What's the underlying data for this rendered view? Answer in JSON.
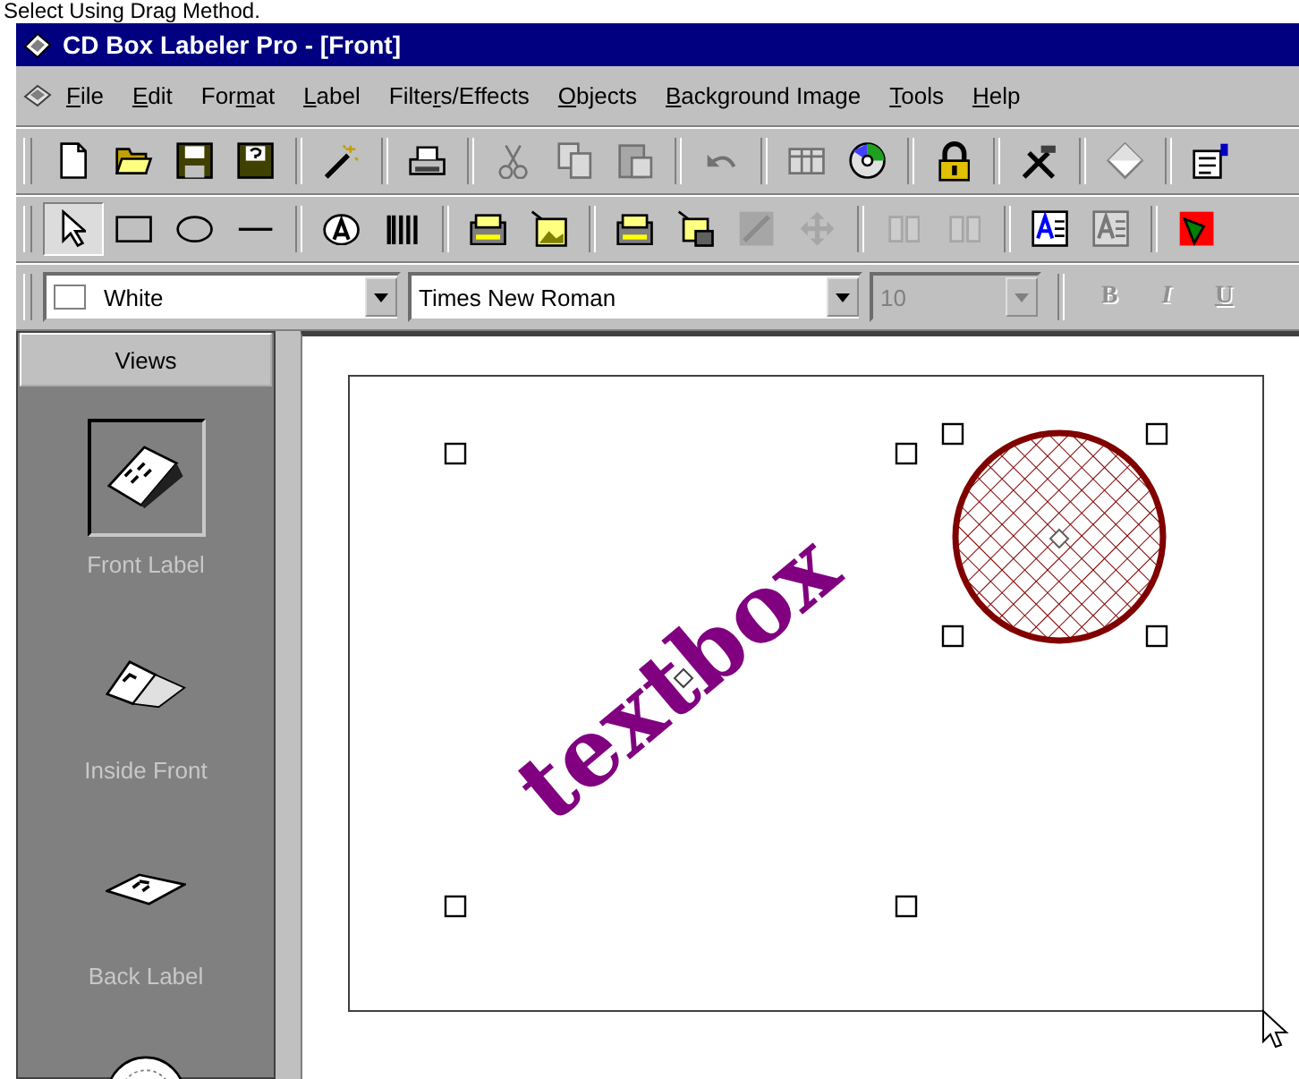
{
  "caption": "Select Using Drag Method.",
  "window": {
    "title": "CD Box Labeler Pro - [Front]"
  },
  "menu": [
    {
      "access_key": "F",
      "label_end": "ile"
    },
    {
      "access_key": "E",
      "label_end": "dit"
    },
    {
      "label_start": "For",
      "access_key": "m",
      "label_end": "at"
    },
    {
      "access_key": "L",
      "label_end": "abel"
    },
    {
      "label_start": "Filte",
      "access_key": "r",
      "label_end": "s/Effects"
    },
    {
      "access_key": "O",
      "label_end": "bjects"
    },
    {
      "access_key": "B",
      "label_end": "ackground Image"
    },
    {
      "access_key": "T",
      "label_end": "ools"
    },
    {
      "access_key": "H",
      "label_end": "elp"
    }
  ],
  "toolbars": [
    [
      {
        "kind": "new",
        "disabled": false
      },
      {
        "kind": "open",
        "disabled": false
      },
      {
        "kind": "save",
        "disabled": false
      },
      {
        "kind": "saveas",
        "disabled": false
      },
      {
        "kind": "separator"
      },
      {
        "kind": "wand",
        "disabled": false
      },
      {
        "kind": "separator"
      },
      {
        "kind": "print",
        "disabled": false
      },
      {
        "kind": "separator"
      },
      {
        "kind": "cut",
        "disabled": true
      },
      {
        "kind": "copy",
        "disabled": true
      },
      {
        "kind": "paste",
        "disabled": true
      },
      {
        "kind": "separator"
      },
      {
        "kind": "undo",
        "disabled": true
      },
      {
        "kind": "separator"
      },
      {
        "kind": "grid",
        "disabled": true
      },
      {
        "kind": "cd",
        "disabled": false
      },
      {
        "kind": "separator"
      },
      {
        "kind": "lock",
        "disabled": false
      },
      {
        "kind": "separator"
      },
      {
        "kind": "tools",
        "disabled": false
      },
      {
        "kind": "separator"
      },
      {
        "kind": "diamond",
        "disabled": false
      },
      {
        "kind": "separator"
      },
      {
        "kind": "props",
        "disabled": false
      }
    ],
    [
      {
        "kind": "pointer",
        "disabled": false,
        "selected": true
      },
      {
        "kind": "rect",
        "disabled": false,
        "selected": false
      },
      {
        "kind": "ellipse",
        "disabled": false,
        "selected": false
      },
      {
        "kind": "line",
        "disabled": false,
        "selected": false
      },
      {
        "kind": "separator"
      },
      {
        "kind": "texttool",
        "disabled": false
      },
      {
        "kind": "barcode",
        "disabled": false
      },
      {
        "kind": "separator"
      },
      {
        "kind": "scanner",
        "disabled": false
      },
      {
        "kind": "picture",
        "disabled": false
      },
      {
        "kind": "separator"
      },
      {
        "kind": "scanner",
        "disabled": false
      },
      {
        "kind": "pictures",
        "disabled": false
      },
      {
        "kind": "resize",
        "disabled": true
      },
      {
        "kind": "move",
        "disabled": true
      },
      {
        "kind": "separator"
      },
      {
        "kind": "flip",
        "disabled": true
      },
      {
        "kind": "flip",
        "disabled": true
      },
      {
        "kind": "separator"
      },
      {
        "kind": "textframe",
        "disabled": false
      },
      {
        "kind": "textframe",
        "disabled": true
      },
      {
        "kind": "separator"
      },
      {
        "kind": "framedpicture",
        "disabled": false
      }
    ]
  ],
  "format_bar": {
    "color": {
      "value": "White"
    },
    "font": {
      "value": "Times New Roman",
      "disabled": false
    },
    "size": {
      "value": "10",
      "disabled": true
    },
    "style_buttons": [
      {
        "label": "B",
        "kind": "bold",
        "disabled": true
      },
      {
        "label": "I",
        "kind": "italic",
        "disabled": true
      },
      {
        "label": "U",
        "kind": "underline",
        "disabled": true
      }
    ]
  },
  "sidebar": {
    "header": "Views",
    "items": [
      {
        "kind": "front",
        "label": "Front Label",
        "selected": true
      },
      {
        "kind": "inside",
        "label": "Inside Front",
        "selected": false
      },
      {
        "kind": "back",
        "label": "Back Label",
        "selected": false
      },
      {
        "kind": "disc",
        "selected": false
      }
    ]
  },
  "canvas": {
    "objects": [
      {
        "kind": "text",
        "text": "textbox",
        "color": "#800080",
        "selected": true
      },
      {
        "kind": "circle",
        "color": "#800000",
        "selected": true
      }
    ]
  }
}
